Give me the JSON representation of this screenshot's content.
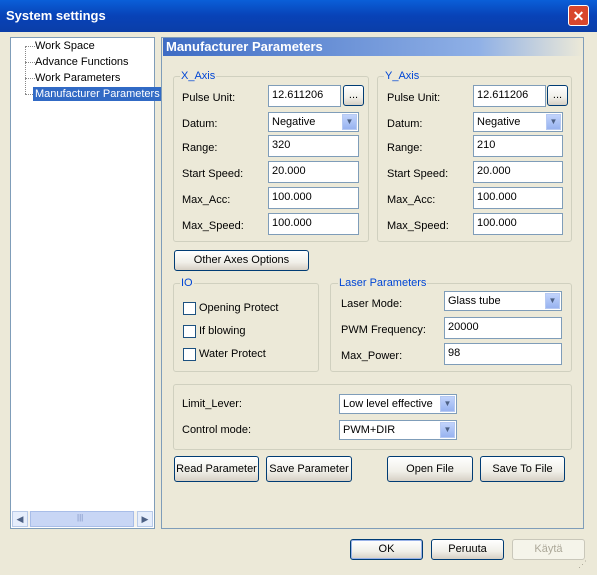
{
  "window": {
    "title": "System settings",
    "close_label": "✕"
  },
  "tree": {
    "items": [
      "Work Space",
      "Advance Functions",
      "Work Parameters",
      "Manufacturer Parameters"
    ],
    "scroll_left": "◀",
    "scroll_right": "▶",
    "thumb_grip": "|||"
  },
  "panel": {
    "title": "Manufacturer Parameters",
    "x_axis": {
      "legend": "X_Axis",
      "pulse_unit_label": "Pulse Unit:",
      "pulse_unit": "12.611206",
      "datum_label": "Datum:",
      "datum": "Negative",
      "range_label": "Range:",
      "range": "320",
      "start_speed_label": "Start Speed:",
      "start_speed": "20.000",
      "max_acc_label": "Max_Acc:",
      "max_acc": "100.000",
      "max_speed_label": "Max_Speed:",
      "max_speed": "100.000"
    },
    "y_axis": {
      "legend": "Y_Axis",
      "pulse_unit_label": "Pulse Unit:",
      "pulse_unit": "12.611206",
      "datum_label": "Datum:",
      "datum": "Negative",
      "range_label": "Range:",
      "range": "210",
      "start_speed_label": "Start Speed:",
      "start_speed": "20.000",
      "max_acc_label": "Max_Acc:",
      "max_acc": "100.000",
      "max_speed_label": "Max_Speed:",
      "max_speed": "100.000"
    },
    "browse_label": "...",
    "dropdown_arrow": "▼",
    "other_axes_label": "Other Axes Options",
    "io": {
      "legend": "IO",
      "opening_protect": "Opening Protect",
      "if_blowing": "If blowing",
      "water_protect": "Water Protect"
    },
    "laser": {
      "legend": "Laser Parameters",
      "laser_mode_label": "Laser Mode:",
      "laser_mode": "Glass tube",
      "pwm_frequency_label": "PWM Frequency:",
      "pwm_frequency": "20000",
      "max_power_label": "Max_Power:",
      "max_power": "98"
    },
    "limit_lever_label": "Limit_Lever:",
    "limit_lever": "Low level effective",
    "control_mode_label": "Control mode:",
    "control_mode": "PWM+DIR",
    "read_parameter": "Read Parameter",
    "save_parameter": "Save Parameter",
    "open_file": "Open File",
    "save_to_file": "Save To File"
  },
  "footer": {
    "ok": "OK",
    "cancel": "Peruuta",
    "apply": "Käytä"
  }
}
